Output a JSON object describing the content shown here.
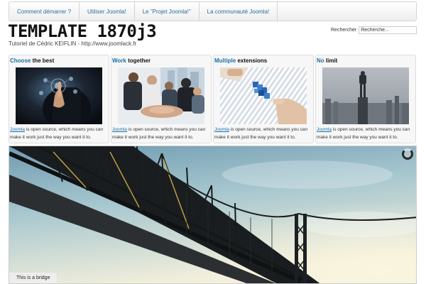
{
  "menu": {
    "items": [
      {
        "label": "Comment démarrer ?"
      },
      {
        "label": "Utiliser Joomla!"
      },
      {
        "label": "Le \"Projet Joomla!\""
      },
      {
        "label": "La communauté Joomla!"
      }
    ]
  },
  "header": {
    "title": "TEMPLATE 1870j3",
    "subtitle": "Tutoriel de Cédric KEIFLIN - http://www.joomlack.fr"
  },
  "search": {
    "label": "Rechercher",
    "placeholder": "Recherche..."
  },
  "features": [
    {
      "accent": "Choose",
      "rest": " the best",
      "link": "Joomla",
      "text": " is open source, which means you can make it work just the way you want it to."
    },
    {
      "accent": "Work",
      "rest": " together",
      "link": "Joomla",
      "text": " is open source, which means you can make it work just the way you want it to."
    },
    {
      "accent": "Multiple",
      "rest": " extensions",
      "link": "Joomla",
      "text": " is open source, which means you can make it work just the way you want it to."
    },
    {
      "accent": "No",
      "rest": " limit",
      "link": "Joomla",
      "text": " is open source, which means you can make it work just the way you want it to."
    }
  ],
  "slider": {
    "caption": "This is a bridge"
  },
  "colors": {
    "link": "#1a6fa8",
    "menu_text": "#2a6e9e"
  }
}
